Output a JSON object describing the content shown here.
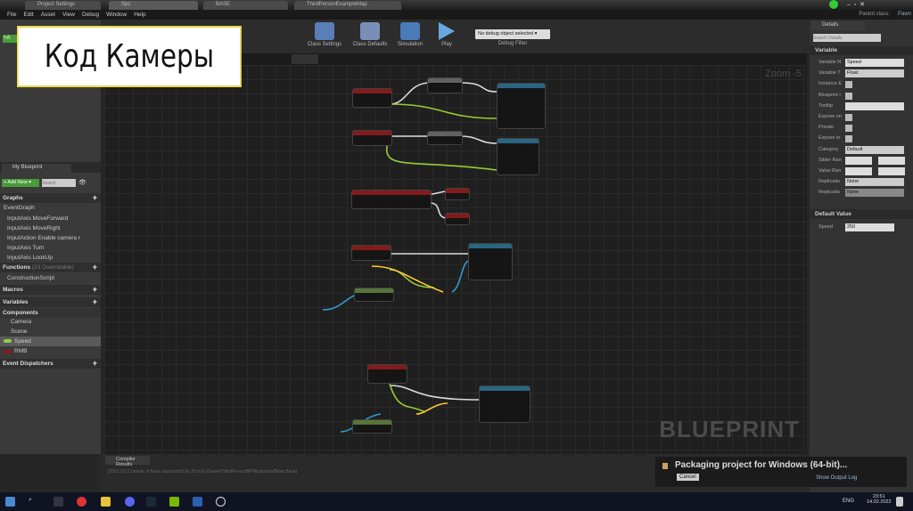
{
  "overlay_title": "Код Камеры",
  "tabs": [
    "Project Settings",
    "Spc",
    "BASE",
    "ThirdPersonExampleMap"
  ],
  "window": {
    "parent_class_label": "Parent class:",
    "parent_class": "Pawn"
  },
  "menu": [
    "File",
    "Edit",
    "Asset",
    "View",
    "Debug",
    "Window",
    "Help"
  ],
  "toolbar": {
    "buttons": [
      "Class Settings",
      "Class Defaults",
      "Simulation",
      "Play"
    ],
    "debug_select": "No debug object selected ▾",
    "debug_filter": "Debug Filter"
  },
  "graph": {
    "zoom": "Zoom -5",
    "watermark": "BLUEPRINT"
  },
  "my_blueprint": {
    "tab": "My Blueprint",
    "add_new": "+ Add New ▾",
    "search_placeholder": "Search",
    "graphs_label": "Graphs",
    "event_graph": "EventGraph",
    "events": [
      "InputAxis MoveForward",
      "InputAxis MoveRight",
      "InputAction Enable camera r",
      "InputAxis Turn",
      "InputAxis LookUp"
    ],
    "functions_label": "Functions",
    "functions_overridable": "(23 Overridable)",
    "construction_script": "ConstructionScript",
    "macros_label": "Macros",
    "variables_label": "Variables",
    "components_label": "Components",
    "components": [
      "Camera",
      "Scene"
    ],
    "variables": [
      {
        "name": "Speed",
        "color": "#8bd14a"
      },
      {
        "name": "RMB",
        "color": "#8a1a1a"
      }
    ],
    "event_dispatchers_label": "Event Dispatchers"
  },
  "details": {
    "tab": "Details",
    "search_placeholder": "Search Details",
    "variable_section": "Variable",
    "rows": [
      {
        "label": "Variable N",
        "type": "text",
        "value": "Speed"
      },
      {
        "label": "Variable T",
        "type": "select",
        "value": "Float"
      },
      {
        "label": "Instance E",
        "type": "check"
      },
      {
        "label": "Blueprint I",
        "type": "check"
      },
      {
        "label": "Tooltip",
        "type": "text",
        "value": ""
      },
      {
        "label": "Expose on",
        "type": "check"
      },
      {
        "label": "Private",
        "type": "check"
      },
      {
        "label": "Expose to",
        "type": "check"
      },
      {
        "label": "Category",
        "type": "select",
        "value": "Default"
      },
      {
        "label": "Slider Ran",
        "type": "pair"
      },
      {
        "label": "Value Ran",
        "type": "pair"
      },
      {
        "label": "Replicatio",
        "type": "select",
        "value": "None"
      },
      {
        "label": "Replicatio",
        "type": "select",
        "value": "None"
      }
    ],
    "default_section": "Default Value",
    "default_label": "Speed",
    "default_value": "250"
  },
  "bottom": {
    "tab": "Compiler Results",
    "log": "[2051.51] Compile of Base successful! [in 35 ms] (/Game/ThirdPersonBP/Blueprints/Base.Base)"
  },
  "toast": {
    "message": "Packaging project for Windows (64-bit)...",
    "cancel": "Cancel",
    "show_log": "Show Output Log"
  },
  "taskbar": {
    "lang": "ENG",
    "time": "23:51",
    "date": "14.02.2022"
  }
}
